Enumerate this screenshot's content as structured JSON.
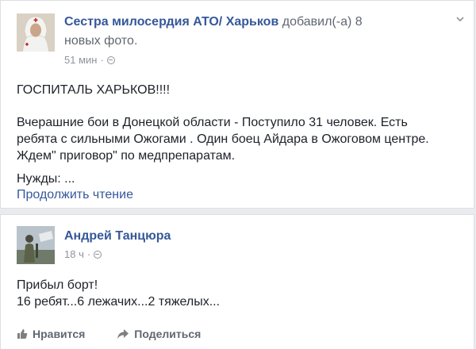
{
  "post1": {
    "author": "Сестра милосердия АТО/ Харьков",
    "action_line1": "добавил(-а) 8",
    "action_line2": "новых фото.",
    "time": "51 мин",
    "dot": "·",
    "title": "ГОСПИТАЛЬ ХАРЬКОВ!!!!",
    "body_line1": "Вчерашние бои в Донецкой области - Поступило 31 человек. Есть",
    "body_line2": "ребята с сильными Ожогами . Один боец Айдара в Ожоговом центре.",
    "body_line3": "Ждем\" приговор\" по медпрепаратам.",
    "needs": "Нужды: ...",
    "read_more": "Продолжить чтение",
    "icons": {
      "privacy": "globe-icon",
      "menu": "chevron-down-icon"
    }
  },
  "post2": {
    "author": "Андрей Танцюра",
    "time": "18 ч",
    "dot": "·",
    "line1": "Прибыл борт!",
    "line2": "16 ребят...6 лежачих...2 тяжелых...",
    "like_label": "Нравится",
    "share_label": "Поделиться",
    "icons": {
      "privacy": "globe-icon",
      "like": "thumbs-up-icon",
      "share": "share-arrow-icon"
    }
  },
  "colors": {
    "link": "#365899",
    "meta": "#90949c",
    "text": "#1d2129"
  }
}
